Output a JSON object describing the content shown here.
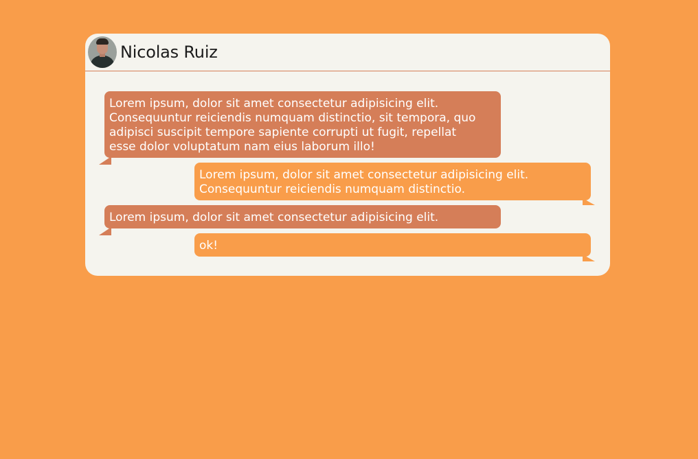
{
  "chat": {
    "contact_name": "Nicolas Ruiz",
    "messages": [
      {
        "direction": "incoming",
        "lines": [
          "Lorem ipsum, dolor sit amet consectetur adipisicing elit.",
          "Consequuntur reiciendis numquam distinctio, sit tempora, quo",
          "adipisci suscipit tempore sapiente corrupti ut fugit, repellat",
          "esse dolor voluptatum nam eius laborum illo!"
        ]
      },
      {
        "direction": "outgoing",
        "lines": [
          "Lorem ipsum, dolor sit amet consectetur adipisicing elit.",
          "Consequuntur reiciendis numquam distinctio."
        ]
      },
      {
        "direction": "incoming",
        "lines": [
          "Lorem ipsum, dolor sit amet consectetur adipisicing elit."
        ]
      },
      {
        "direction": "outgoing",
        "lines": [
          "ok!"
        ]
      }
    ]
  },
  "colors": {
    "page_background": "#f99d4a",
    "card_background": "#f5f4ee",
    "incoming_bubble": "#d57e58",
    "outgoing_bubble": "#f99d4a",
    "bubble_text": "#ffffff"
  }
}
